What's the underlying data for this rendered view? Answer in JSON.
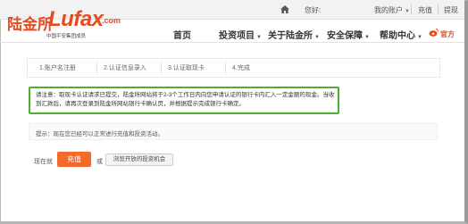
{
  "topbar": {
    "hello": "您好:",
    "my_account": "我的账户",
    "recharge": "充值",
    "withdraw": "提现"
  },
  "logo": {
    "cn": "陆金所",
    "en": "Lufax",
    "dot": ".com",
    "subtitle": "中国平安集团成员"
  },
  "nav": {
    "home": "首页",
    "invest": "投资项目",
    "about": "关于陆金所",
    "security": "安全保障",
    "help": "帮助中心",
    "official": "官方"
  },
  "steps": [
    {
      "label": "1.账户名注册"
    },
    {
      "label": "2.认证信息录入"
    },
    {
      "label": "3.认证取现卡"
    },
    {
      "label": "4.完成"
    }
  ],
  "notice": {
    "text": "请注意：取现卡认证请求已提交，陆金所网站将于2-3个工作日内向您申请认证的银行卡内汇入一定金额的现金。当收到汇款后，请再次登录到陆金所网站银行卡确认页，并根据提示完成银行卡确定。"
  },
  "hint": {
    "text": "提示：现在您已经可以正常进行充值和投资活动。"
  },
  "actions": {
    "now_label": "现在就",
    "recharge_button": "充值",
    "or_label": "或",
    "browse_button": "浏览开放的投资机会"
  },
  "colors": {
    "brand": "#e8491d",
    "notice_border": "#4caf2e",
    "button": "#f26b2a"
  },
  "icons": {
    "home": "home-icon",
    "weibo": "weibo-icon"
  }
}
